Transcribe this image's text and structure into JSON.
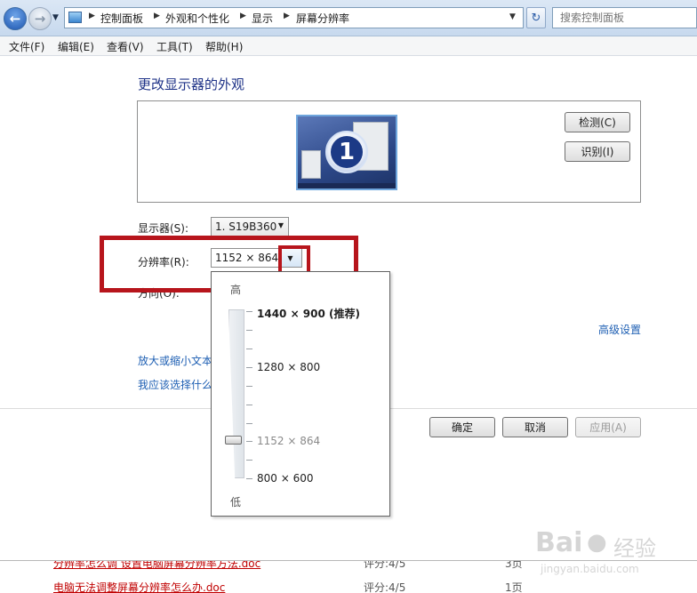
{
  "address_bar": {
    "breadcrumbs": [
      "控制面板",
      "外观和个性化",
      "显示",
      "屏幕分辨率"
    ],
    "search_placeholder": "搜索控制面板"
  },
  "menubar": {
    "items": [
      "文件(F)",
      "编辑(E)",
      "查看(V)",
      "工具(T)",
      "帮助(H)"
    ]
  },
  "main": {
    "title": "更改显示器的外观",
    "monitor_number": "1",
    "detect_button": "检测(C)",
    "identify_button": "识别(I)",
    "display_label": "显示器(S):",
    "display_value": "1. S19B360",
    "resolution_label": "分辨率(R):",
    "resolution_value": "1152 × 864",
    "orientation_label": "方向(O):",
    "advanced_link": "高级设置",
    "link_enlarge_text": "放大或缩小文本",
    "link_which_settings": "我应该选择什么",
    "ok_button": "确定",
    "cancel_button": "取消",
    "apply_button": "应用(A)"
  },
  "resolution_popup": {
    "high_label": "高",
    "low_label": "低",
    "options": [
      "1440 × 900 (推荐)",
      "1280 × 800",
      "1152 × 864",
      "800 × 600"
    ],
    "selected": "1152 × 864"
  },
  "bottom_results": [
    {
      "title": "分辨率怎么调 设置电脑屏幕分辨率方法.doc",
      "score": "评分:4/5",
      "pages": "3页"
    },
    {
      "title": "电脑无法调整屏幕分辨率怎么办.doc",
      "score": "评分:4/5",
      "pages": "1页"
    }
  ],
  "watermark": {
    "brand": "Bai",
    "suffix": "经验",
    "url": "jingyan.baidu.com"
  },
  "colors": {
    "title_blue": "#1e3287",
    "link_blue": "#1e5fb3",
    "annotation_red": "#b7151c",
    "result_red": "#c00000"
  }
}
